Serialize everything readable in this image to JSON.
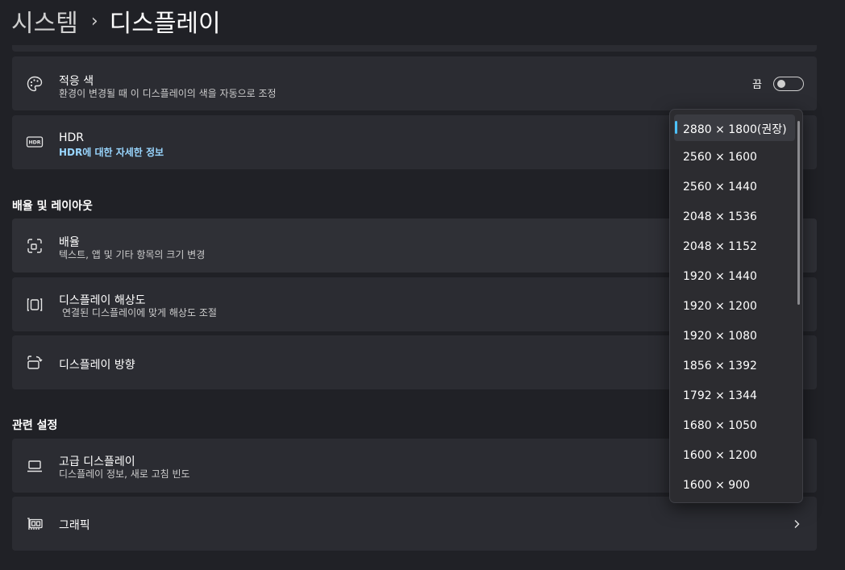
{
  "breadcrumb": {
    "parent": "시스템",
    "separator": "›",
    "current": "디스플레이"
  },
  "cards": {
    "adaptive_color": {
      "title": "적응 색",
      "subtitle": "환경이 변경될 때 이 디스플레이의 색을 자동으로 조정",
      "toggle_label": "끔",
      "toggle_on": false
    },
    "hdr": {
      "title": "HDR",
      "link": "HDR에 대한 자세한 정보"
    },
    "scale": {
      "title": "배율",
      "subtitle": "텍스트, 앱 및 기타 항목의 크기 변경"
    },
    "resolution": {
      "title": "디스플레이 해상도",
      "subtitle": "연결된 디스플레이에 맞게 해상도 조절"
    },
    "orientation": {
      "title": "디스플레이 방향"
    },
    "advanced": {
      "title": "고급 디스플레이",
      "subtitle": "디스플레이 정보, 새로 고침 빈도"
    },
    "graphics": {
      "title": "그래픽"
    }
  },
  "sections": {
    "scale_layout": "배율 및 레이아웃",
    "related": "관련 설정"
  },
  "resolution_dropdown": {
    "selected_index": 0,
    "options": [
      "2880 × 1800(권장)",
      "2560 × 1600",
      "2560 × 1440",
      "2048 × 1536",
      "2048 × 1152",
      "1920 × 1440",
      "1920 × 1200",
      "1920 × 1080",
      "1856 × 1392",
      "1792 × 1344",
      "1680 × 1050",
      "1600 × 1200",
      "1600 × 900"
    ]
  },
  "icons": {
    "adaptive_color": "palette-icon",
    "hdr": "hdr-icon",
    "scale": "scale-icon",
    "resolution": "resolution-icon",
    "orientation": "orientation-icon",
    "advanced": "laptop-icon",
    "graphics": "graphics-card-icon",
    "chevron": "chevron-right-icon"
  },
  "colors": {
    "background": "#202126",
    "card": "#2b2c32",
    "accent": "#4cc2ff",
    "link": "#99d6ff"
  }
}
